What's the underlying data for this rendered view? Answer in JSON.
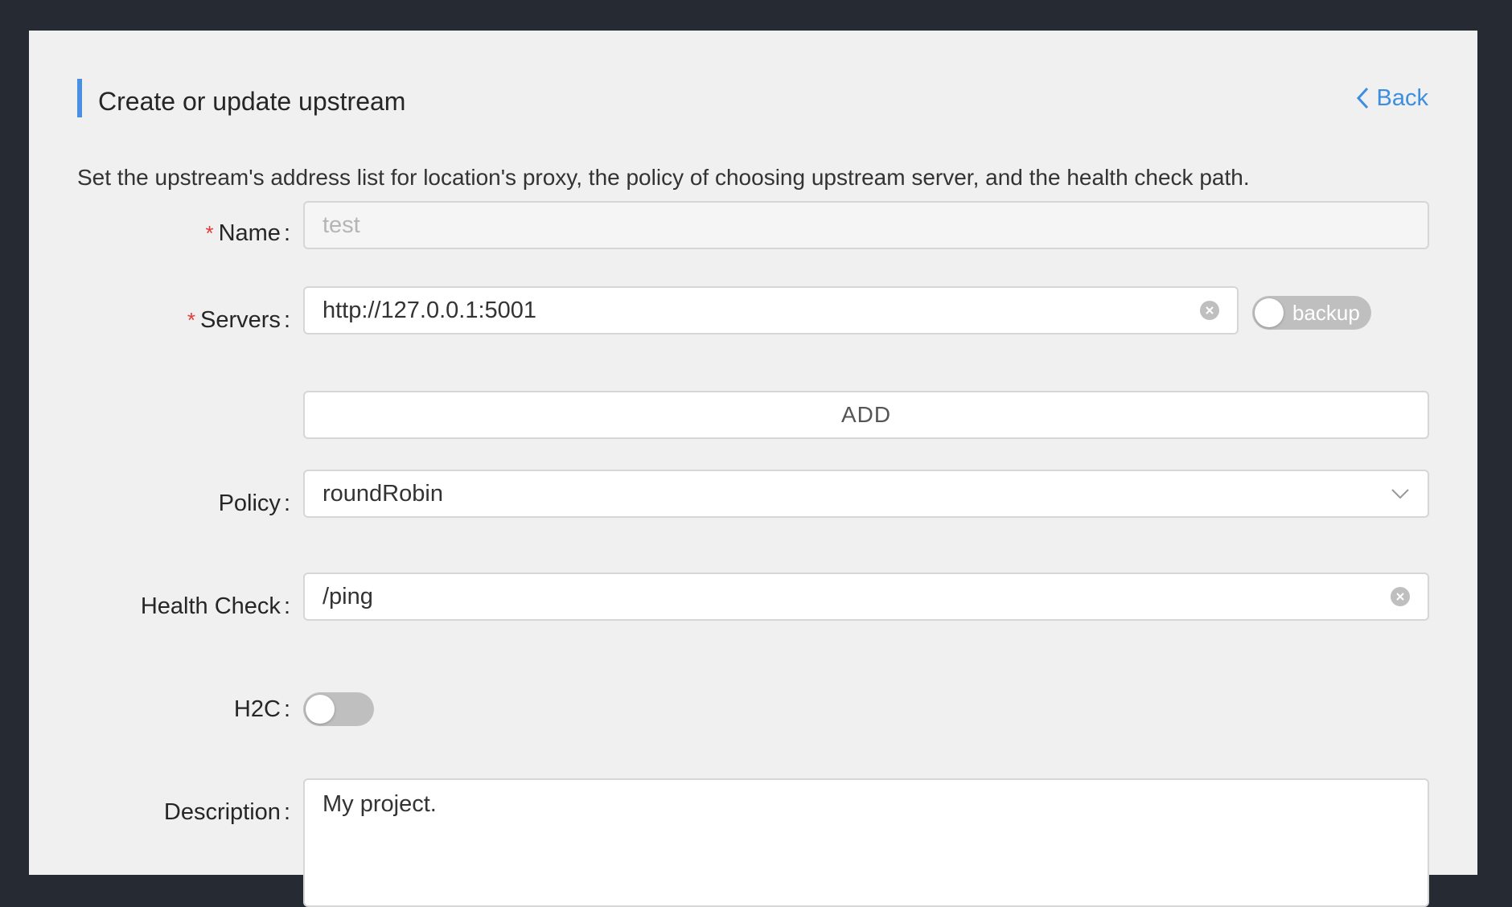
{
  "header": {
    "title": "Create or update upstream",
    "back_label": "Back",
    "subtitle": "Set the upstream's address list for location's proxy, the policy of choosing upstream server, and the health check path.",
    "accent_color": "#4a90e2",
    "link_color": "#3d8ee0"
  },
  "form": {
    "name": {
      "label": "Name",
      "required": true,
      "value": "test"
    },
    "servers": {
      "label": "Servers",
      "required": true,
      "value": "http://127.0.0.1:5001",
      "backup_label": "backup",
      "backup_on": false,
      "add_label": "ADD"
    },
    "policy": {
      "label": "Policy",
      "value": "roundRobin"
    },
    "health_check": {
      "label": "Health Check",
      "value": "/ping"
    },
    "h2c": {
      "label": "H2C",
      "on": false
    },
    "description": {
      "label": "Description",
      "value": "My project."
    }
  },
  "colors": {
    "required_star": "#e23b3b",
    "toggle_off": "#bfbfbf"
  },
  "icons": [
    "chevron-left-icon",
    "clear-icon",
    "chevron-down-icon"
  ]
}
